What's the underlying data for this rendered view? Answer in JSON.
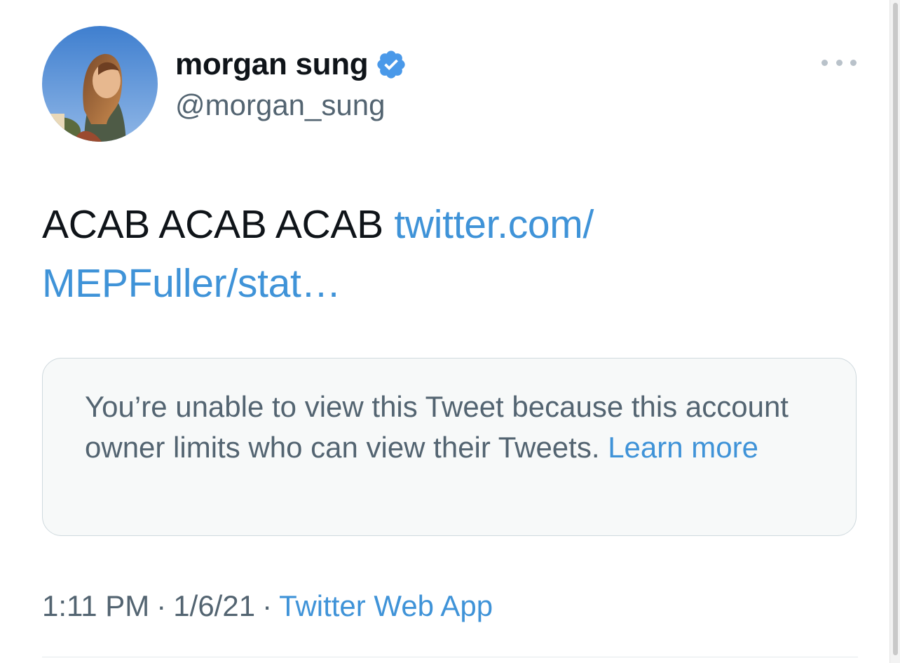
{
  "tweet": {
    "author": {
      "display_name": "morgan sung",
      "handle": "@morgan_sung",
      "verified": true
    },
    "text": "ACAB ACAB ACAB ",
    "link_line1": "twitter.com/",
    "link_line2": "MEPFuller/stat…",
    "quoted_unavailable": {
      "message": "You’re unable to view this Tweet because this account owner limits who can view their Tweets. ",
      "learn_more": "Learn more"
    },
    "meta": {
      "time": "1:11 PM",
      "separator": "·",
      "date": "1/6/21",
      "source": "Twitter Web App"
    }
  },
  "icons": {
    "more": "more-horizontal-icon",
    "verified": "verified-badge-icon"
  },
  "colors": {
    "link": "#3f93d8",
    "verified": "#4a99e9",
    "secondary_text": "#536471",
    "card_background": "#f7f9f9",
    "card_border": "#cfd9de"
  }
}
